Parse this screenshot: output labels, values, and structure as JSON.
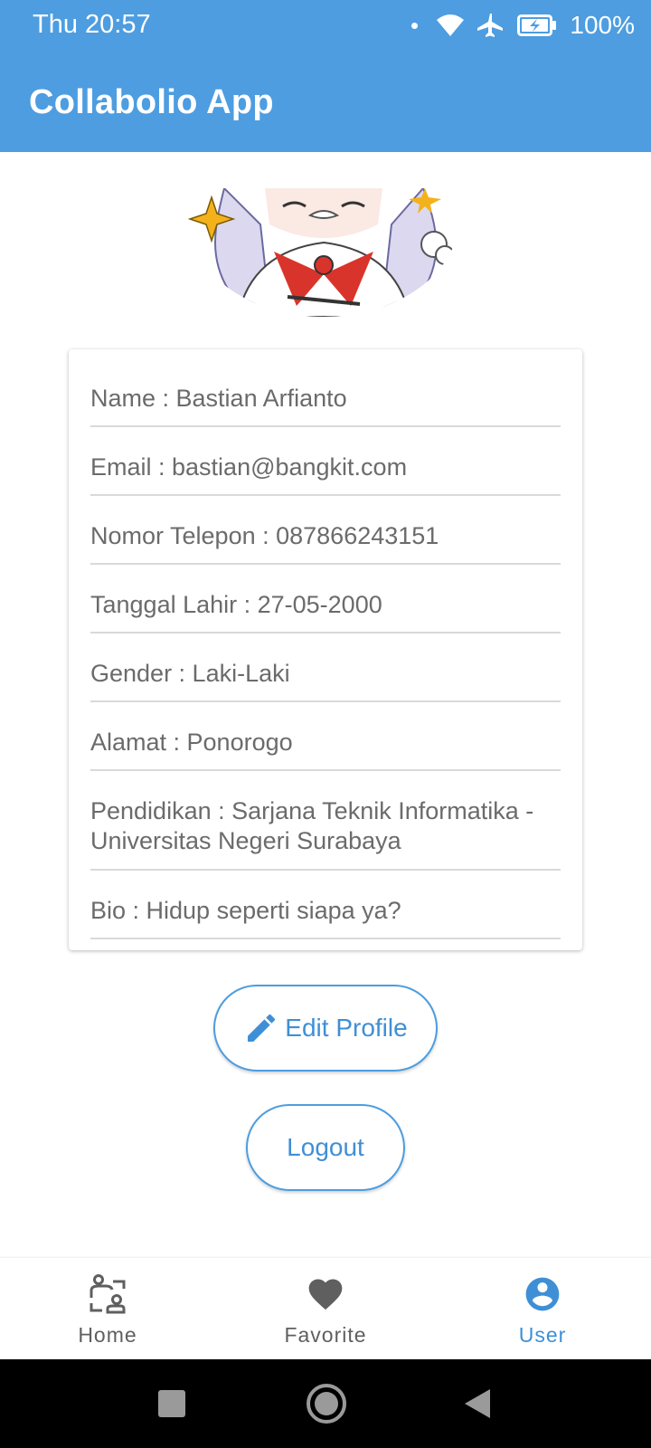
{
  "status_bar": {
    "time": "Thu 20:57",
    "battery": "100%"
  },
  "app_bar": {
    "title": "Collabolio App"
  },
  "profile": {
    "fields": [
      "Name : Bastian Arfianto",
      "Email : bastian@bangkit.com",
      "Nomor Telepon : 087866243151",
      "Tanggal Lahir : 27-05-2000",
      "Gender : Laki-Laki",
      "Alamat : Ponorogo",
      "Pendidikan : Sarjana Teknik Informatika - Universitas Negeri Surabaya",
      "Bio : Hidup seperti siapa ya?"
    ]
  },
  "actions": {
    "edit_label": "Edit Profile",
    "logout_label": "Logout"
  },
  "bottom_nav": {
    "items": [
      {
        "label": "Home",
        "icon": "home-people-icon"
      },
      {
        "label": "Favorite",
        "icon": "heart-icon"
      },
      {
        "label": "User",
        "icon": "account-circle-icon"
      }
    ],
    "active": "User"
  },
  "colors": {
    "primary": "#4d9de0",
    "accent_text": "#3f8fd6",
    "field_text": "#6b6b6b",
    "system_nav": "#000000"
  }
}
